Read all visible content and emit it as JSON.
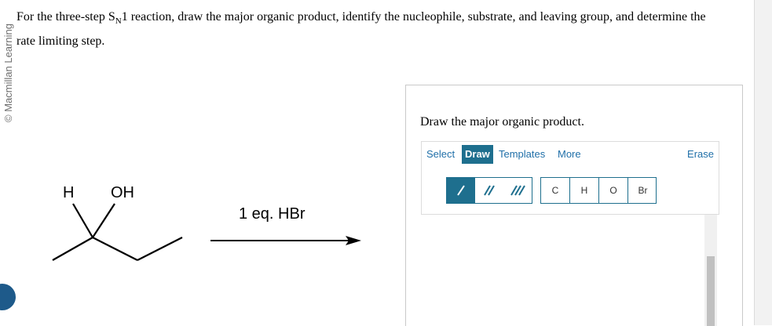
{
  "watermark": "© Macmillan Learning",
  "question": {
    "before": "For the three-step S",
    "sub": "N",
    "after": "1 reaction, draw the major organic product, identify the nucleophile, substrate, and leaving group, and determine the rate limiting step."
  },
  "molecule": {
    "label_h": "H",
    "label_oh": "OH"
  },
  "reaction": {
    "reagent": "1 eq. HBr"
  },
  "panel": {
    "title": "Draw the major organic product.",
    "tabs": [
      "Select",
      "Draw",
      "Templates",
      "More"
    ],
    "active_tab": "Draw",
    "erase": "Erase",
    "bond_tools": [
      "single-bond-icon",
      "double-bond-icon",
      "triple-bond-icon"
    ],
    "atoms": [
      "C",
      "H",
      "O",
      "Br"
    ]
  },
  "colors": {
    "accent": "#1e6f8e",
    "link": "#1f6fa8",
    "brand_dot": "#1e5a8a"
  }
}
